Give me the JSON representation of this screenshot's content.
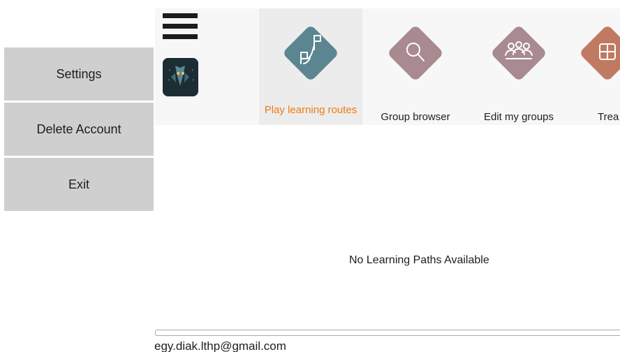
{
  "sidebar": {
    "items": [
      {
        "label": "Settings"
      },
      {
        "label": "Delete Account"
      },
      {
        "label": "Exit"
      }
    ]
  },
  "header": {
    "menu_icon": "hamburger-menu-icon",
    "logo_icon": "owl-logo-icon"
  },
  "tabs": [
    {
      "label": "Play learning routes",
      "icon": "route-flag-icon",
      "color": "#5b8591",
      "active": true,
      "label_color": "#ee7b14"
    },
    {
      "label": "Group browser",
      "icon": "search-icon",
      "color": "#a88a90",
      "active": false
    },
    {
      "label": "Edit my groups",
      "icon": "group-people-icon",
      "color": "#a88a90",
      "active": false
    },
    {
      "label": "Trea",
      "icon": "treasure-map-icon",
      "color": "#c07a62",
      "active": false
    }
  ],
  "main": {
    "message": "No Learning Paths Available"
  },
  "footer": {
    "email": "egy.diak.lthp@gmail.com"
  }
}
